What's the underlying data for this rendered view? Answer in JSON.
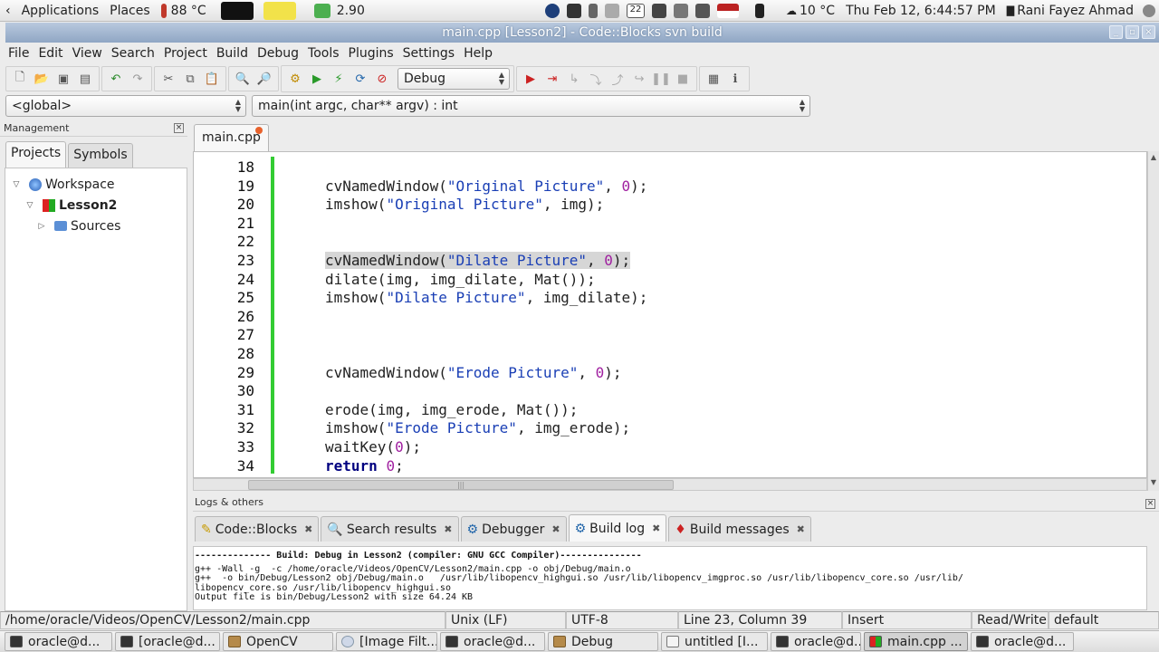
{
  "top_panel": {
    "applications": "Applications",
    "places": "Places",
    "cpu_temp": "88 °C",
    "battery": "2.90",
    "weather": "10 °C",
    "clock": "Thu Feb 12,  6:44:57 PM",
    "user": "Rani Fayez Ahmad",
    "calendar_day": "22"
  },
  "window": {
    "title": "main.cpp [Lesson2] - Code::Blocks svn build"
  },
  "menu": [
    "File",
    "Edit",
    "View",
    "Search",
    "Project",
    "Build",
    "Debug",
    "Tools",
    "Plugins",
    "Settings",
    "Help"
  ],
  "toolbar": {
    "build_target": "Debug"
  },
  "code_toolbar": {
    "scope": "<global>",
    "function": "main(int argc, char** argv) : int"
  },
  "management": {
    "title": "Management",
    "tabs": [
      "Projects",
      "Symbols"
    ],
    "tree": {
      "workspace": "Workspace",
      "project": "Lesson2",
      "folder": "Sources"
    }
  },
  "editor": {
    "tab": "main.cpp",
    "lines": [
      {
        "n": "18",
        "code": ""
      },
      {
        "n": "19",
        "code": "cvNamedWindow(\"Original Picture\", 0);"
      },
      {
        "n": "20",
        "code": "imshow(\"Original Picture\", img);"
      },
      {
        "n": "21",
        "code": ""
      },
      {
        "n": "22",
        "code": ""
      },
      {
        "n": "23",
        "code": "cvNamedWindow(\"Dilate Picture\", 0);"
      },
      {
        "n": "24",
        "code": "dilate(img, img_dilate, Mat());"
      },
      {
        "n": "25",
        "code": "imshow(\"Dilate Picture\", img_dilate);"
      },
      {
        "n": "26",
        "code": ""
      },
      {
        "n": "27",
        "code": ""
      },
      {
        "n": "28",
        "code": ""
      },
      {
        "n": "29",
        "code": "cvNamedWindow(\"Erode Picture\", 0);"
      },
      {
        "n": "30",
        "code": ""
      },
      {
        "n": "31",
        "code": "erode(img, img_erode, Mat());"
      },
      {
        "n": "32",
        "code": "imshow(\"Erode Picture\", img_erode);"
      },
      {
        "n": "33",
        "code": "waitKey(0);"
      },
      {
        "n": "34",
        "code": "return 0;"
      }
    ]
  },
  "logs": {
    "title": "Logs & others",
    "tabs": [
      "Code::Blocks",
      "Search results",
      "Debugger",
      "Build log",
      "Build messages"
    ],
    "active_tab": "Build log",
    "lines": [
      "-------------- Build: Debug in Lesson2 (compiler: GNU GCC Compiler)---------------",
      "g++ -Wall -g  -c /home/oracle/Videos/OpenCV/Lesson2/main.cpp -o obj/Debug/main.o",
      "g++  -o bin/Debug/Lesson2 obj/Debug/main.o   /usr/lib/libopencv_highgui.so /usr/lib/libopencv_imgproc.so /usr/lib/libopencv_core.so /usr/lib/",
      "libopencv_core.so /usr/lib/libopencv_highgui.so",
      "Output file is bin/Debug/Lesson2 with size 64.24 KB"
    ]
  },
  "status": {
    "path": "/home/oracle/Videos/OpenCV/Lesson2/main.cpp",
    "eol": "Unix (LF)",
    "encoding": "UTF-8",
    "position": "Line 23, Column 39",
    "mode": "Insert",
    "access": "Read/Write",
    "profile": "default"
  },
  "taskbar": [
    "oracle@d...",
    "[oracle@d...",
    "OpenCV",
    "[Image Filt...",
    "oracle@d...",
    "Debug",
    "untitled [I...",
    "oracle@d...",
    "main.cpp ...",
    "oracle@d..."
  ],
  "taskbar_active_index": 8,
  "colors": {
    "string": "#1a3fb5",
    "number": "#a020a0",
    "keyword": "#000080",
    "changebar": "#33cc33",
    "titlebar": "#8fa6c4"
  }
}
